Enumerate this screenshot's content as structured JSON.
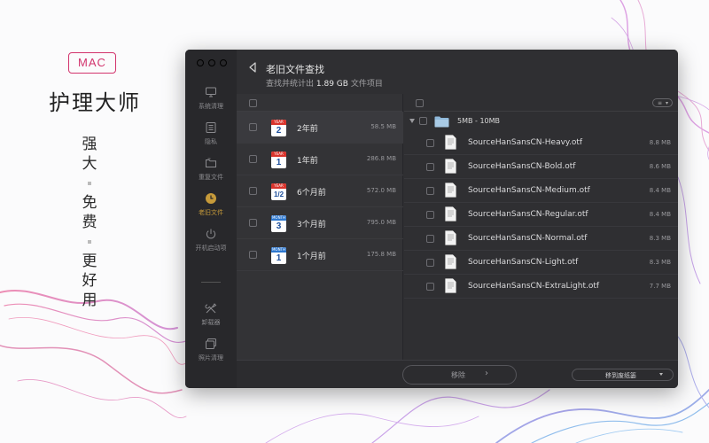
{
  "promo": {
    "badge": "MAC",
    "title": "护理大师",
    "slogan": [
      "强",
      "大",
      "免",
      "费",
      "更",
      "好",
      "用"
    ]
  },
  "window": {
    "header": {
      "title": "老旧文件查找",
      "subtitle_prefix": "查找并统计出",
      "subtitle_size": "1.89 GB",
      "subtitle_suffix": "文件项目"
    },
    "sidebar": {
      "items": [
        {
          "label": "系统清理",
          "icon": "monitor-icon"
        },
        {
          "label": "隐私",
          "icon": "privacy-list-icon"
        },
        {
          "label": "重复文件",
          "icon": "duplicate-files-icon"
        },
        {
          "label": "老旧文件",
          "icon": "clock-icon"
        },
        {
          "label": "开机启动项",
          "icon": "power-icon"
        },
        {
          "label": "卸载器",
          "icon": "tools-icon"
        },
        {
          "label": "照片清理",
          "icon": "photos-icon"
        }
      ],
      "active": "老旧文件"
    },
    "age_groups": [
      {
        "cal_top": "YEAR",
        "cal_num": "2",
        "label": "2年前",
        "size": "58.5 MB"
      },
      {
        "cal_top": "YEAR",
        "cal_num": "1",
        "label": "1年前",
        "size": "286.8 MB"
      },
      {
        "cal_top": "YEAR",
        "cal_num": "1/2",
        "label": "6个月前",
        "size": "572.0 MB"
      },
      {
        "cal_top": "MONTH",
        "cal_num": "3",
        "label": "3个月前",
        "size": "795.0 MB"
      },
      {
        "cal_top": "MONTH",
        "cal_num": "1",
        "label": "1个月前",
        "size": "175.8 MB"
      }
    ],
    "file_group": {
      "label": "5MB - 10MB"
    },
    "files": [
      {
        "name": "SourceHanSansCN-Heavy.otf",
        "size": "8.8 MB"
      },
      {
        "name": "SourceHanSansCN-Bold.otf",
        "size": "8.6 MB"
      },
      {
        "name": "SourceHanSansCN-Medium.otf",
        "size": "8.4 MB"
      },
      {
        "name": "SourceHanSansCN-Regular.otf",
        "size": "8.4 MB"
      },
      {
        "name": "SourceHanSansCN-Normal.otf",
        "size": "8.3 MB"
      },
      {
        "name": "SourceHanSansCN-Light.otf",
        "size": "8.3 MB"
      },
      {
        "name": "SourceHanSansCN-ExtraLight.otf",
        "size": "7.7 MB"
      }
    ],
    "footer": {
      "move_label": "移除",
      "trash_label": "移到废纸篓"
    }
  },
  "colors": {
    "accent": "#d2336c",
    "active_nav": "#c69a3a"
  }
}
